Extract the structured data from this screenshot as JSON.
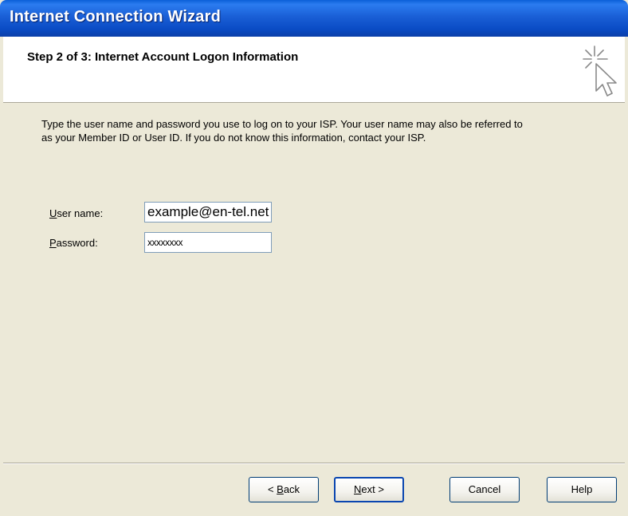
{
  "window": {
    "title": "Internet Connection Wizard"
  },
  "header": {
    "step_title": "Step 2 of 3: Internet Account Logon Information",
    "icon": "wizard-cursor-sparkle-icon"
  },
  "main": {
    "intro_text": "Type the user name and password you use to log on to your ISP. Your user name may also be referred to as your Member ID or User ID. If you do not know this information, contact your ISP.",
    "username": {
      "label_accel": "U",
      "label_rest": "ser name:",
      "value": "example@en-tel.net"
    },
    "password": {
      "label_accel": "P",
      "label_rest": "assword:",
      "value": "xxxxxxxx"
    }
  },
  "buttons": {
    "back": {
      "prefix": "< ",
      "accel": "B",
      "rest": "ack"
    },
    "next": {
      "accel": "N",
      "rest": "ext >"
    },
    "cancel": "Cancel",
    "help": "Help"
  },
  "colors": {
    "titlebar": "#1a5fd6",
    "dialog_bg": "#ece9d8",
    "header_bg": "#ffffff",
    "textbox_border": "#7f9db9",
    "default_button_border": "#0a46b0"
  }
}
